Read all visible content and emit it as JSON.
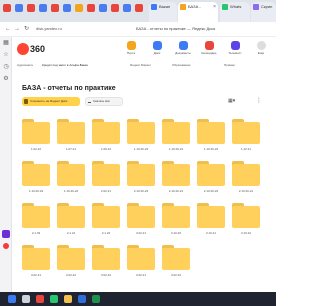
{
  "browser": {
    "tabs": [
      {
        "label": "",
        "color": "#e8453c"
      },
      {
        "label": "",
        "color": "#4a7cf0"
      },
      {
        "label": "",
        "color": "#e8453c"
      },
      {
        "label": "",
        "color": "#4a7cf0"
      },
      {
        "label": "",
        "color": "#e8453c"
      },
      {
        "label": "",
        "color": "#4a7cf0"
      },
      {
        "label": "",
        "color": "#f2a51d"
      },
      {
        "label": "",
        "color": "#e8453c"
      },
      {
        "label": "",
        "color": "#4a7cf0"
      },
      {
        "label": "",
        "color": "#e8453c"
      },
      {
        "label": "",
        "color": "#4a7cf0"
      },
      {
        "label": "",
        "color": "#e8453c"
      }
    ],
    "tab_blue_label": "Вакан",
    "tab_active_label": "БАЗА - ",
    "tab_after_label": "Whats",
    "tab_last_label": "Скрин",
    "url": "disk.yandex.ru",
    "page_title": "БАЗА - отчеты по практике — Яндекс Диск",
    "back": "←",
    "forward": "→",
    "reload": "↻",
    "home": "⌂"
  },
  "header": {
    "logo_text": "360",
    "services": [
      {
        "label": "Почта",
        "color": "#f2a51d"
      },
      {
        "label": "Диск",
        "color": "#3d7bf4"
      },
      {
        "label": "Документы",
        "color": "#3d7bf4"
      },
      {
        "label": "Календарь",
        "color": "#e8453c"
      },
      {
        "label": "Телемост",
        "color": "#5b45e6"
      }
    ],
    "user_label": "Ещё"
  },
  "bookmarks": [
    "Аудиокнига",
    "Кредит под залог в Альфа-Банке",
    "Яндекс Маркет",
    "Образование",
    "Пример"
  ],
  "main": {
    "title": "БАЗА - отчеты по практике",
    "save_label": "Сохранить на Яндекс Диск",
    "download_label": "Скачать всё",
    "view_icon": "▦▾",
    "more_icon": "⋮",
    "folders": [
      "1.02.22",
      "1.07.21",
      "1.09.22",
      "1.10.20-23",
      "1.10.20-21",
      "1.10.20-22",
      "1.12.21",
      "1.10.20-23",
      "1.10.20-22",
      "2.02.21",
      "2.10.20-23",
      "2.10.20-21",
      "2.10.20-22",
      "2.10.20-21",
      "2.1.03",
      "2.1.21",
      "2.1.22",
      "3.02.21",
      "3.10.20",
      "3.10.21",
      "3.10.22",
      "3.02.21",
      "3.02.22",
      "3.02.22",
      "3.02.21",
      "3.02.22"
    ]
  },
  "taskbar": {
    "icons": [
      {
        "name": "start",
        "color": "#3d7bf4"
      },
      {
        "name": "search",
        "color": "#cfd3da"
      },
      {
        "name": "yandex",
        "color": "#e8453c"
      },
      {
        "name": "whatsapp",
        "color": "#2ac66f"
      },
      {
        "name": "explorer",
        "color": "#f2c14e"
      },
      {
        "name": "word",
        "color": "#2f6fdc"
      },
      {
        "name": "excel",
        "color": "#1f8f4e"
      }
    ]
  }
}
